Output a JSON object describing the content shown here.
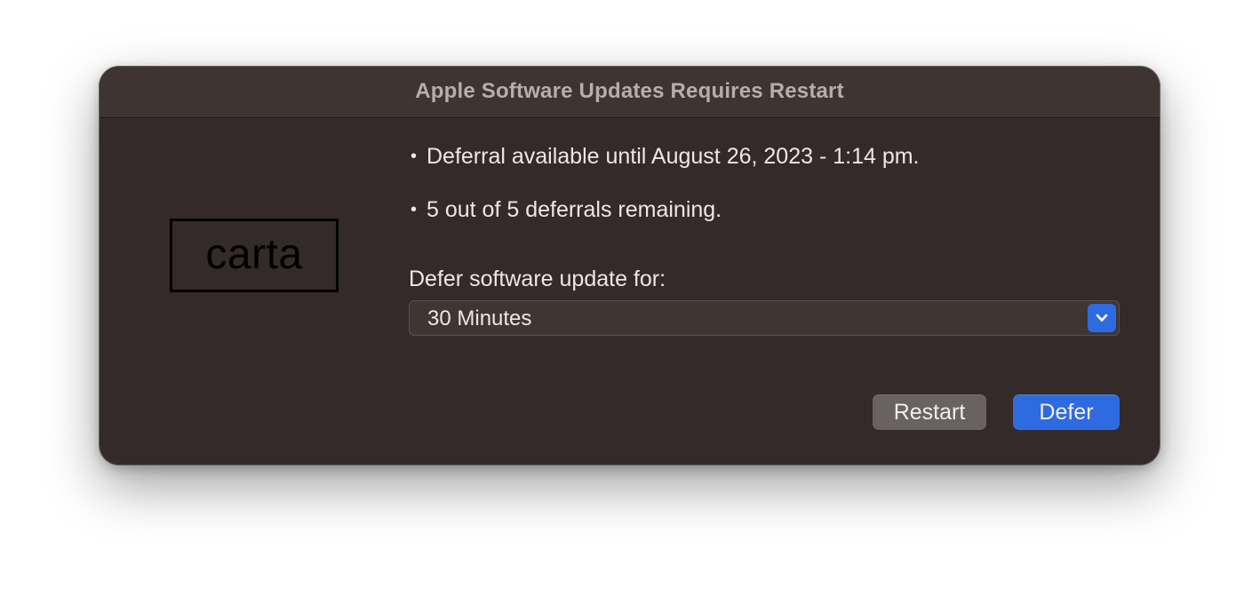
{
  "dialog": {
    "title": "Apple Software Updates Requires Restart",
    "logo_text": "carta",
    "bullets": [
      "Deferral available until August 26, 2023 - 1:14 pm.",
      "5 out of 5 deferrals remaining."
    ],
    "bullet_symbol": "•",
    "defer_label": "Defer software update for:",
    "defer_select": {
      "selected": "30 Minutes",
      "icon": "chevron-down-icon"
    },
    "buttons": {
      "restart_label": "Restart",
      "defer_label": "Defer"
    }
  },
  "colors": {
    "window_background": "#342a29",
    "titlebar_background": "#3e3533",
    "accent": "#2f6be0",
    "secondary_button": "#6a6260"
  }
}
